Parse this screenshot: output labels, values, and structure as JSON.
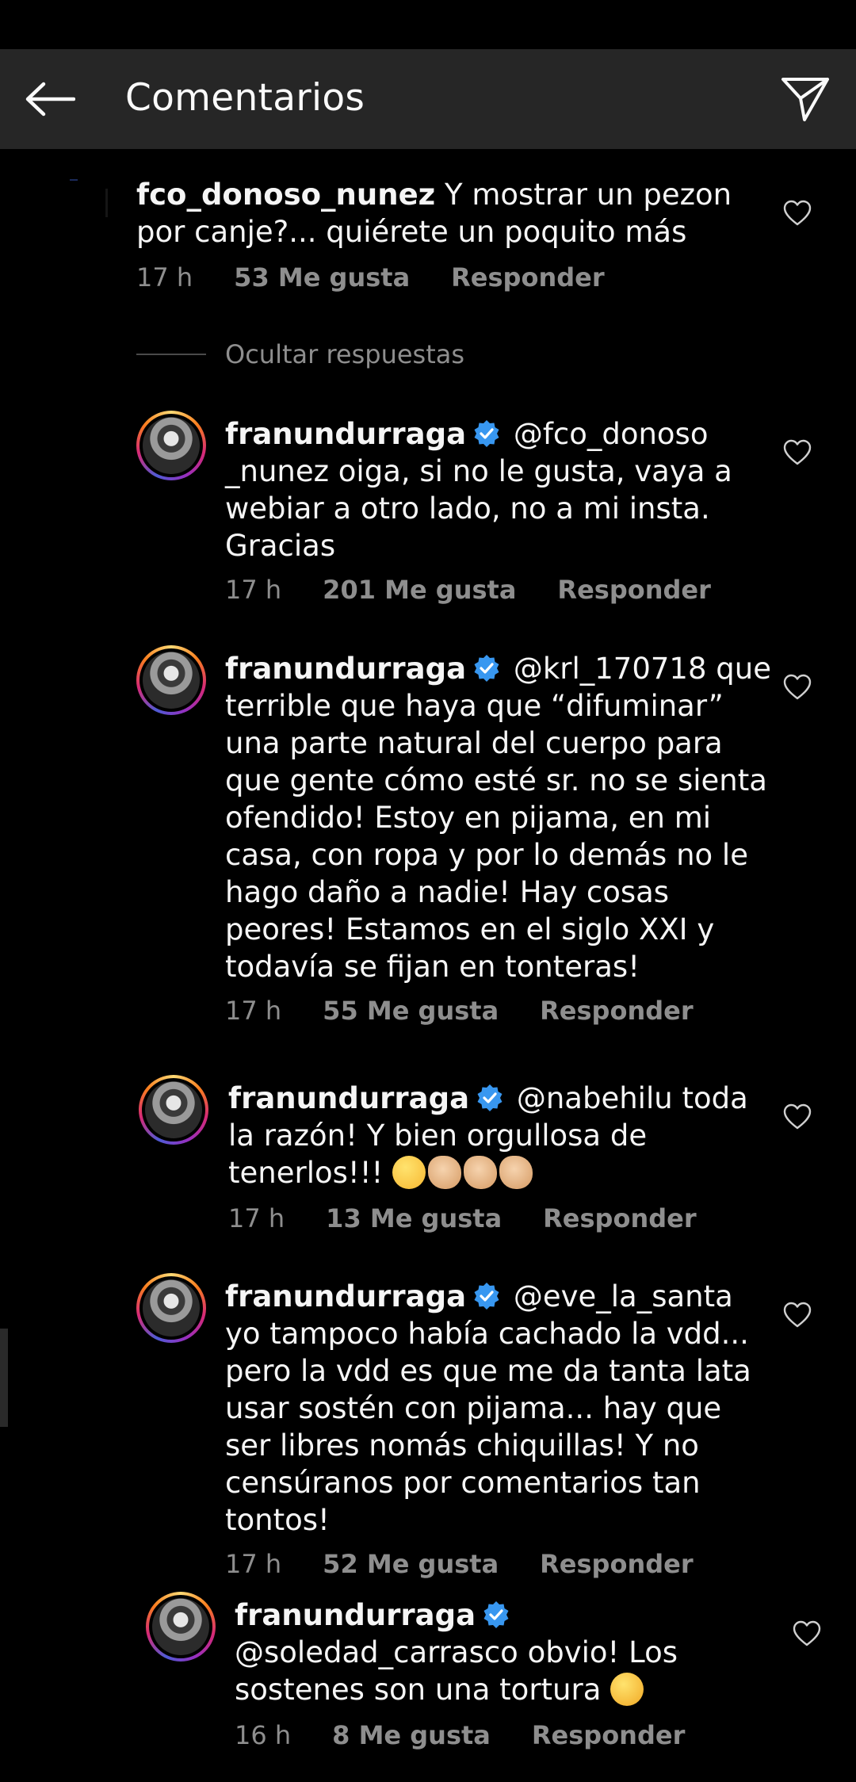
{
  "header": {
    "title": "Comentarios"
  },
  "hide_replies_label": "Ocultar respuestas",
  "colors": {
    "background": "#000000",
    "appbar": "#262626",
    "meta": "#8e8e8e",
    "verified": "#3897f0"
  },
  "icons": {
    "back": "arrow-left-icon",
    "send": "paper-plane-icon",
    "like": "heart-outline-icon",
    "verified": "verified-badge-icon"
  },
  "comments": [
    {
      "user": "fco_donoso_nunez",
      "text": "Y mostrar un pezon por canje?... quiérete un poquito más",
      "time": "17 h",
      "likes": "53 Me gusta",
      "reply": "Responder"
    },
    {
      "user": "franundurraga",
      "text": "@fco_donoso _nunez oiga, si no le gusta, vaya a webiar a otro lado, no a mi insta. Gracias",
      "time": "17 h",
      "likes": "201 Me gusta",
      "reply": "Responder"
    },
    {
      "user": "franundurraga",
      "text": "@krl_170718 que terrible que haya que “difuminar” una parte natural del cuerpo para que gente cómo esté sr. no se sienta ofendido! Estoy en pijama, en mi casa, con ropa y por lo demás no le hago daño a nadie! Hay cosas peores! Estamos en el siglo XXI y todavía se fijan en tonteras!",
      "time": "17 h",
      "likes": "55 Me gusta",
      "reply": "Responder"
    },
    {
      "user": "franundurraga",
      "text": "@nabehilu toda la razón! Y bien orgullosa de tenerlos!!!",
      "emojis": [
        "smiling-face-emoji",
        "clapping-hands-emoji",
        "clapping-hands-emoji",
        "clapping-hands-emoji"
      ],
      "time": "17 h",
      "likes": "13 Me gusta",
      "reply": "Responder"
    },
    {
      "user": "franundurraga",
      "text": "@eve_la_santa yo tampoco había cachado la vdd... pero la vdd es que me da tanta lata usar sostén con pijama... hay que ser libres nomás chiquillas! Y no censúranos por comentarios tan tontos!",
      "time": "17 h",
      "likes": "52 Me gusta",
      "reply": "Responder"
    },
    {
      "user": "franundurraga",
      "text": "@soledad_carrasco obvio! Los sostenes son una tortura",
      "emojis": [
        "persevering-face-emoji"
      ],
      "time": "16 h",
      "likes": "8 Me gusta",
      "reply": "Responder"
    }
  ]
}
